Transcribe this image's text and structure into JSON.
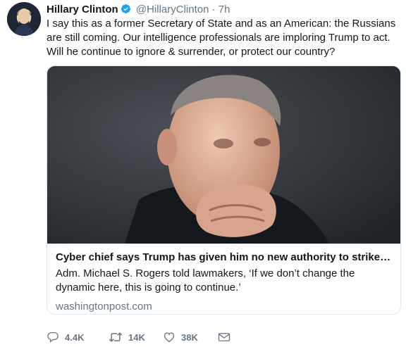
{
  "tweet": {
    "author": {
      "name": "Hillary Clinton",
      "handle": "@HillaryClinton",
      "verified": true
    },
    "separator": "·",
    "time": "7h",
    "text": "I say this as a former Secretary of State and as an American: the Russians are still coming. Our intelligence professionals are imploring Trump to act. Will he continue to ignore & surrender, or protect our country?"
  },
  "card": {
    "image_icon": "photo-of-admiral",
    "title": "Cyber chief says Trump has given him no new authority to strike at R...",
    "description": "Adm. Michael S. Rogers told lawmakers, ‘If we don’t change the dynamic here, this is going to continue.’",
    "domain": "washingtonpost.com"
  },
  "actions": {
    "reply": {
      "icon": "reply-icon",
      "count": "4.4K"
    },
    "retweet": {
      "icon": "retweet-icon",
      "count": "14K"
    },
    "like": {
      "icon": "heart-icon",
      "count": "38K"
    },
    "dm": {
      "icon": "envelope-icon"
    }
  },
  "colors": {
    "verified_blue": "#1da1f2",
    "secondary_text": "#657786",
    "primary_text": "#14171a",
    "border": "#e1e8ed"
  }
}
